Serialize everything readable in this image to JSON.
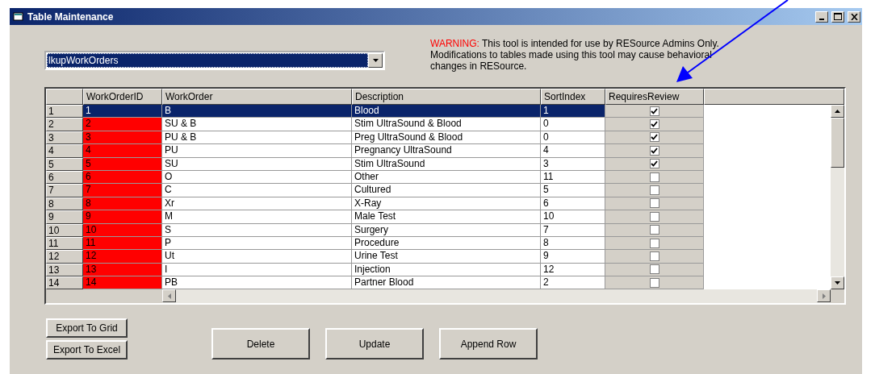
{
  "window": {
    "title": "Table Maintenance"
  },
  "table_select": {
    "value": "lkupWorkOrders"
  },
  "warning": {
    "label": "WARNING:",
    "text": "This tool is intended for use by RESource Admins Only. Modifications to tables made using this tool may cause behavioral changes in RESource."
  },
  "grid": {
    "columns": [
      "WorkOrderID",
      "WorkOrder",
      "Description",
      "SortIndex",
      "RequiresReview"
    ],
    "rows": [
      {
        "row_number": "1",
        "work_order_id": "1",
        "work_order": "B",
        "description": "Blood",
        "sort_index": "1",
        "requires_review": true,
        "selected": true
      },
      {
        "row_number": "2",
        "work_order_id": "2",
        "work_order": "SU & B",
        "description": "Stim UltraSound & Blood",
        "sort_index": "0",
        "requires_review": true,
        "selected": false
      },
      {
        "row_number": "3",
        "work_order_id": "3",
        "work_order": "PU & B",
        "description": "Preg UltraSound & Blood",
        "sort_index": "0",
        "requires_review": true,
        "selected": false
      },
      {
        "row_number": "4",
        "work_order_id": "4",
        "work_order": "PU",
        "description": "Pregnancy UltraSound",
        "sort_index": "4",
        "requires_review": true,
        "selected": false
      },
      {
        "row_number": "5",
        "work_order_id": "5",
        "work_order": "SU",
        "description": "Stim UltraSound",
        "sort_index": "3",
        "requires_review": true,
        "selected": false
      },
      {
        "row_number": "6",
        "work_order_id": "6",
        "work_order": "O",
        "description": "Other",
        "sort_index": "11",
        "requires_review": false,
        "selected": false
      },
      {
        "row_number": "7",
        "work_order_id": "7",
        "work_order": "C",
        "description": "Cultured",
        "sort_index": "5",
        "requires_review": false,
        "selected": false
      },
      {
        "row_number": "8",
        "work_order_id": "8",
        "work_order": "Xr",
        "description": "X-Ray",
        "sort_index": "6",
        "requires_review": false,
        "selected": false
      },
      {
        "row_number": "9",
        "work_order_id": "9",
        "work_order": "M",
        "description": "Male Test",
        "sort_index": "10",
        "requires_review": false,
        "selected": false
      },
      {
        "row_number": "10",
        "work_order_id": "10",
        "work_order": "S",
        "description": "Surgery",
        "sort_index": "7",
        "requires_review": false,
        "selected": false
      },
      {
        "row_number": "11",
        "work_order_id": "11",
        "work_order": "P",
        "description": "Procedure",
        "sort_index": "8",
        "requires_review": false,
        "selected": false
      },
      {
        "row_number": "12",
        "work_order_id": "12",
        "work_order": "Ut",
        "description": "Urine Test",
        "sort_index": "9",
        "requires_review": false,
        "selected": false
      },
      {
        "row_number": "13",
        "work_order_id": "13",
        "work_order": "I",
        "description": "Injection",
        "sort_index": "12",
        "requires_review": false,
        "selected": false
      },
      {
        "row_number": "14",
        "work_order_id": "14",
        "work_order": "PB",
        "description": "Partner Blood",
        "sort_index": "2",
        "requires_review": false,
        "selected": false
      }
    ]
  },
  "export_buttons": [
    "Export To Grid",
    "Export To Excel"
  ],
  "action_buttons": [
    "Delete",
    "Update",
    "Append Row"
  ]
}
